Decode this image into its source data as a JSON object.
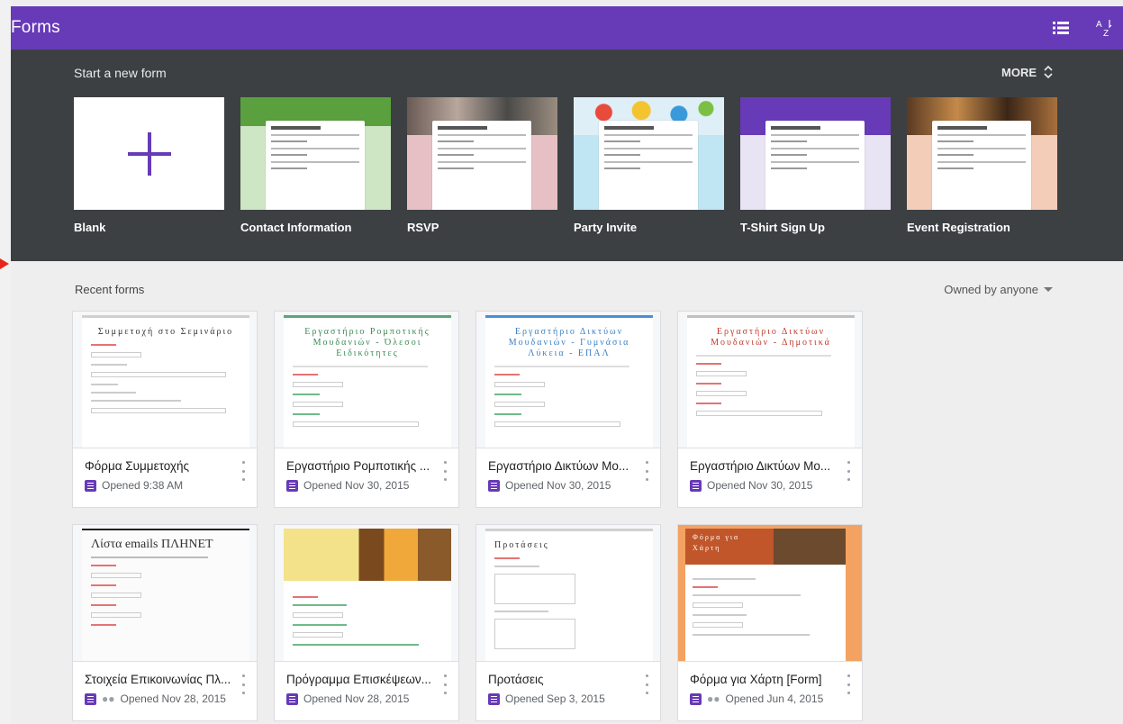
{
  "app": {
    "title": "Forms"
  },
  "appbar": {
    "list_view_icon": "list-view-icon",
    "sort_icon": "sort-az-icon"
  },
  "templates": {
    "header": "Start a new form",
    "more_label": "MORE",
    "items": [
      {
        "label": "Blank"
      },
      {
        "label": "Contact Information"
      },
      {
        "label": "RSVP"
      },
      {
        "label": "Party Invite"
      },
      {
        "label": "T-Shirt Sign Up"
      },
      {
        "label": "Event Registration"
      }
    ]
  },
  "recent": {
    "header": "Recent forms",
    "filter_label": "Owned by anyone",
    "forms": [
      {
        "title": "Φόρμα Συμμετοχής",
        "opened": "Opened  9:38 AM",
        "shared": false,
        "thumb_title": "Συμμετοχή στο Σεμινάριο"
      },
      {
        "title": "Εργαστήριο Ρομποτικής ...",
        "opened": "Opened  Nov 30, 2015",
        "shared": false,
        "thumb_title": "Εργαστήριο Ρομποτικής Μουδανιών - Όλεσοι Ειδικότητες"
      },
      {
        "title": "Εργαστήριο Δικτύων Μο...",
        "opened": "Opened  Nov 30, 2015",
        "shared": false,
        "thumb_title": "Εργαστήριο Δικτύων Μουδανιών - Γυμνάσια Λύκεια - ΕΠΑΛ"
      },
      {
        "title": "Εργαστήριο Δικτύων Μο...",
        "opened": "Opened  Nov 30, 2015",
        "shared": false,
        "thumb_title": "Εργαστήριο Δικτύων Μουδανιών - Δημοτικά"
      },
      {
        "title": "Στοιχεία Επικοινωνίας Πλ...",
        "opened": "Opened  Nov 28, 2015",
        "shared": true,
        "thumb_title": "Λίστα emails ΠΛΗΝΕΤ"
      },
      {
        "title": "Πρόγραμμα Επισκέψεων...",
        "opened": "Opened  Nov 28, 2015",
        "shared": false,
        "thumb_title": ""
      },
      {
        "title": "Προτάσεις",
        "opened": "Opened  Sep 3, 2015",
        "shared": false,
        "thumb_title": "Προτάσεις"
      },
      {
        "title": "Φόρμα για Χάρτη [Form]",
        "opened": "Opened  Jun 4, 2015",
        "shared": true,
        "thumb_title": "Φόρμα για Χάρτη"
      }
    ]
  },
  "colors": {
    "brand": "#673ab7",
    "template_bg": "#3c4043",
    "page_bg": "#eeeeee"
  }
}
